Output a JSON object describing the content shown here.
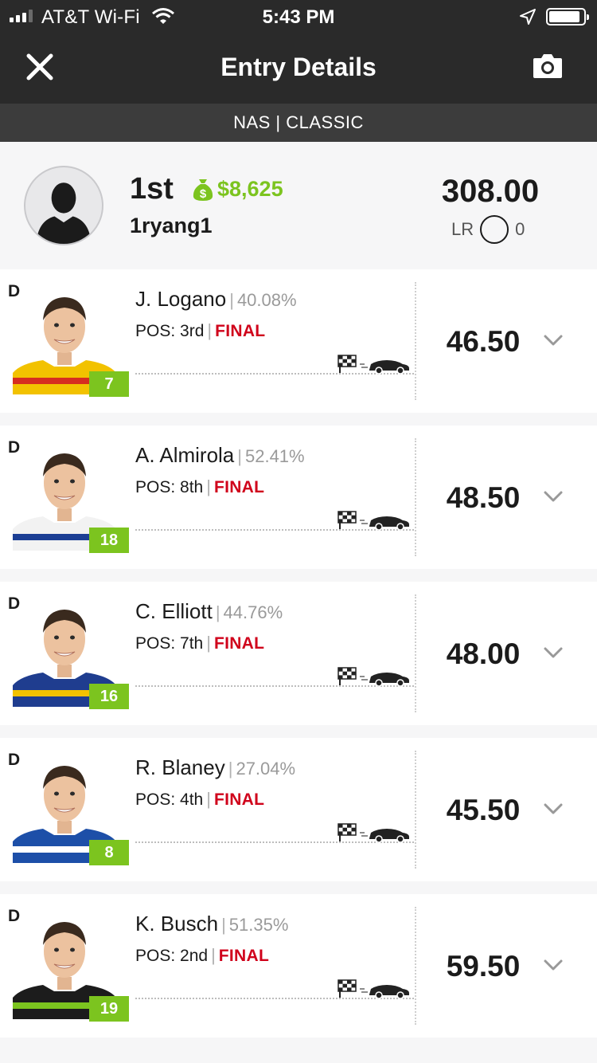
{
  "status_bar": {
    "carrier": "AT&T Wi-Fi",
    "time": "5:43 PM"
  },
  "navbar": {
    "title": "Entry Details"
  },
  "contest": {
    "label": "NAS | CLASSIC"
  },
  "entry": {
    "rank": "1st",
    "prize": "$8,625",
    "username": "1ryang1",
    "points": "308.00",
    "lr_label": "LR",
    "lr_value": "0"
  },
  "players": [
    {
      "slot": "D",
      "name": "J. Logano",
      "owned": "40.08%",
      "pos": "POS: 3rd",
      "status": "FINAL",
      "number": "7",
      "score": "46.50",
      "suit": "#f2c200",
      "suit2": "#d62d20"
    },
    {
      "slot": "D",
      "name": "A. Almirola",
      "owned": "52.41%",
      "pos": "POS: 8th",
      "status": "FINAL",
      "number": "18",
      "score": "48.50",
      "suit": "#f2f2f2",
      "suit2": "#1c3f94"
    },
    {
      "slot": "D",
      "name": "C. Elliott",
      "owned": "44.76%",
      "pos": "POS: 7th",
      "status": "FINAL",
      "number": "16",
      "score": "48.00",
      "suit": "#1f3d8f",
      "suit2": "#f2c200"
    },
    {
      "slot": "D",
      "name": "R. Blaney",
      "owned": "27.04%",
      "pos": "POS: 4th",
      "status": "FINAL",
      "number": "8",
      "score": "45.50",
      "suit": "#1d4fa8",
      "suit2": "#ffffff"
    },
    {
      "slot": "D",
      "name": "K. Busch",
      "owned": "51.35%",
      "pos": "POS: 2nd",
      "status": "FINAL",
      "number": "19",
      "score": "59.50",
      "suit": "#1c1c1c",
      "suit2": "#7cc41f"
    }
  ],
  "colors": {
    "accent_green": "#7cc41f",
    "final_red": "#d0021b",
    "header_dark": "#2a2a2a"
  },
  "icons": {
    "close": "close-icon",
    "camera": "camera-icon",
    "prize": "money-bag-icon",
    "expand": "chevron-down-icon",
    "race_progress": "checkered-flag-car-icon"
  }
}
